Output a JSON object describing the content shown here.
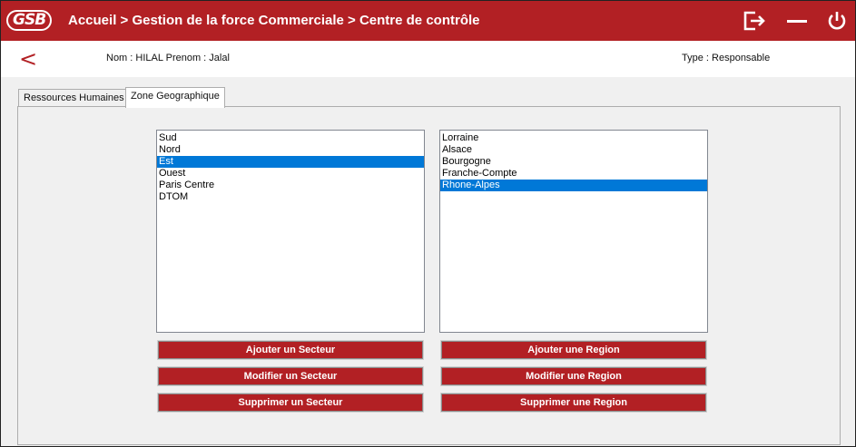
{
  "header": {
    "logo_text": "GSB",
    "breadcrumb": "Accueil > Gestion de la force Commerciale > Centre de contrôle",
    "icons": [
      "logout-icon",
      "minimize-icon",
      "power-icon"
    ]
  },
  "user_bar": {
    "back_label": "<",
    "name_text": "Nom : HILAL  Prenom : Jalal",
    "type_text": "Type : Responsable"
  },
  "tabs": [
    {
      "label": "Ressources Humaines",
      "active": false
    },
    {
      "label": "Zone Geographique",
      "active": true
    }
  ],
  "secteurs": {
    "items": [
      "Sud",
      "Nord",
      "Est",
      "Ouest",
      "Paris Centre",
      "DTOM"
    ],
    "selected": "Est",
    "buttons": {
      "add": "Ajouter un Secteur",
      "edit": "Modifier un Secteur",
      "delete": "Supprimer un Secteur"
    }
  },
  "regions": {
    "items": [
      "Lorraine",
      "Alsace",
      "Bourgogne",
      "Franche-Compte",
      "Rhone-Alpes"
    ],
    "selected": "Rhone-Alpes",
    "buttons": {
      "add": "Ajouter une Region",
      "edit": "Modifier une Region",
      "delete": "Supprimer une Region"
    }
  },
  "colors": {
    "accent": "#b22024",
    "selection": "#0078d7"
  }
}
